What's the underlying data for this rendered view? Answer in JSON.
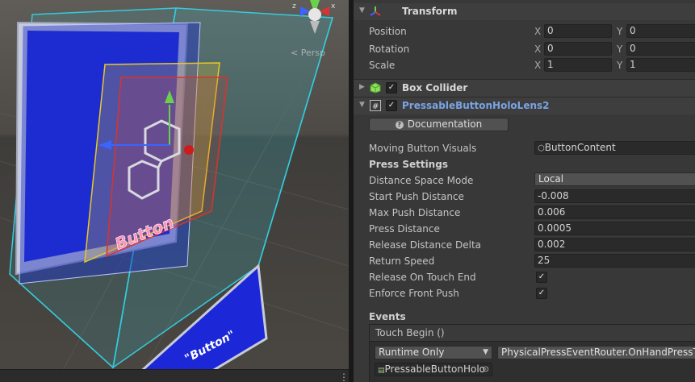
{
  "scene_view": {
    "gizmo_axes": {
      "y": "y",
      "x": "x",
      "z": "z"
    },
    "projection_label": "< Persp",
    "menu_icon": "kebab-menu-icon",
    "button_mesh_text": "Button",
    "button_mesh_text_lower": "\"Button\""
  },
  "transform": {
    "title": "Transform",
    "icon": "transform-icon",
    "rows": [
      {
        "label": "Position",
        "x_axis": "X",
        "x": "0",
        "y_axis": "Y",
        "y": "0"
      },
      {
        "label": "Rotation",
        "x_axis": "X",
        "x": "0",
        "y_axis": "Y",
        "y": "0"
      },
      {
        "label": "Scale",
        "x_axis": "X",
        "x": "1",
        "y_axis": "Y",
        "y": "1"
      }
    ]
  },
  "box_collider": {
    "title": "Box Collider",
    "icon": "box-collider-icon",
    "enabled": "✓"
  },
  "pressable": {
    "title": "PressableButtonHoloLens2",
    "icon": "script-hash-icon",
    "enabled": "✓",
    "documentation_label": "Documentation",
    "moving_visuals_label": "Moving Button Visuals",
    "moving_visuals_value": "ButtonContent",
    "press_settings_header": "Press Settings",
    "fields": [
      {
        "label": "Distance Space Mode",
        "value": "Local"
      },
      {
        "label": "Start Push Distance",
        "value": "-0.008"
      },
      {
        "label": "Max Push Distance",
        "value": "0.006"
      },
      {
        "label": "Press Distance",
        "value": "0.0005"
      },
      {
        "label": "Release Distance Delta",
        "value": "0.002"
      },
      {
        "label": "Return Speed",
        "value": "25"
      }
    ],
    "toggles": [
      {
        "label": "Release On Touch End",
        "checked": "✓"
      },
      {
        "label": "Enforce Front Push",
        "checked": "✓"
      }
    ],
    "events_header": "Events",
    "touch_begin_label": "Touch Begin ()",
    "runtime_option": "Runtime Only",
    "method_value": "PhysicalPressEventRouter.OnHandPressTo",
    "object_value": "PressableButtonHolo"
  },
  "colors": {
    "inspector_bg": "#383838",
    "link_title": "#7aa3e5",
    "scene_sky": "#4e4b47",
    "backplate": "#1c28d8",
    "cyan_wire": "#33ccdd",
    "yellow_plate": "#e8c829",
    "red_plate": "#d9342b"
  }
}
